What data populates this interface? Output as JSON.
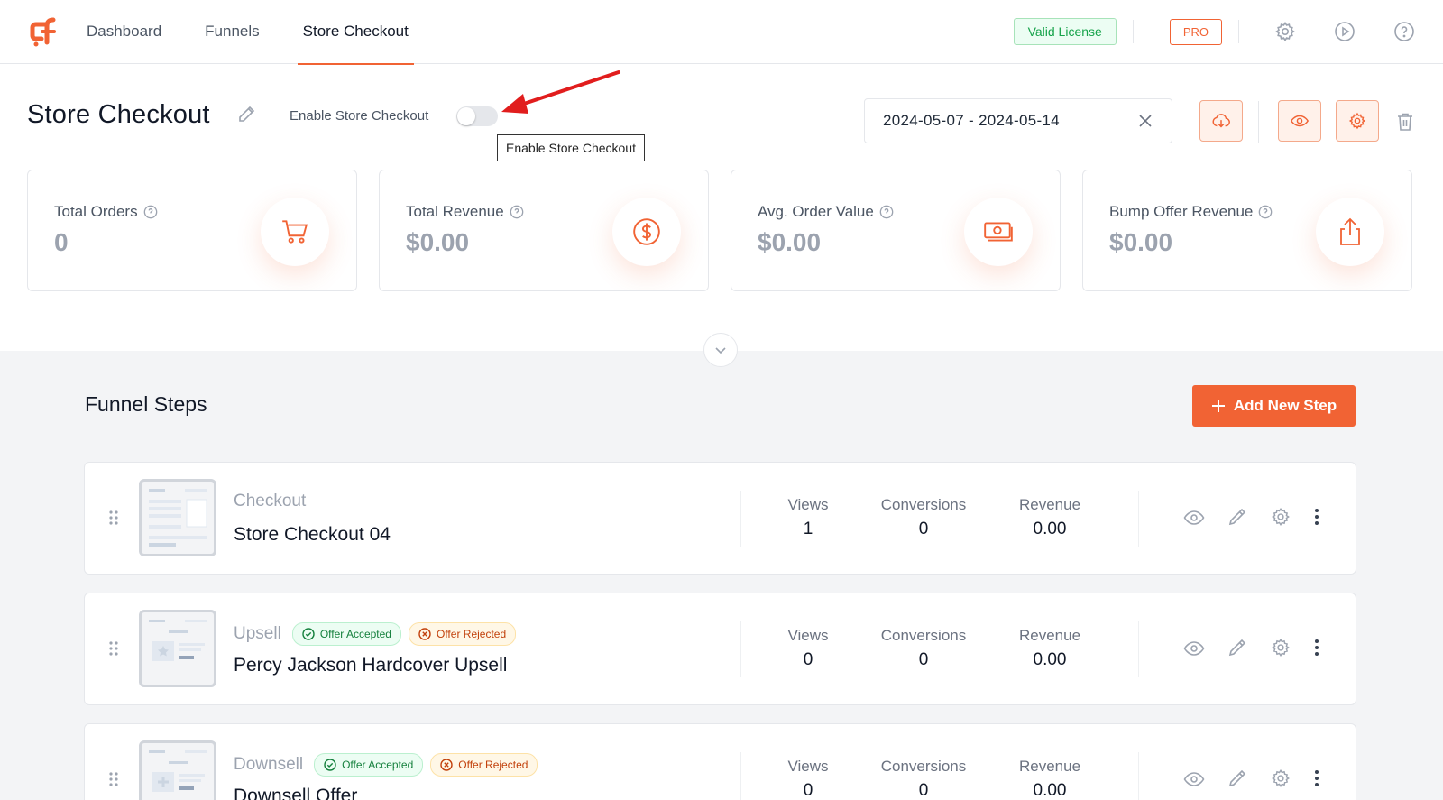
{
  "nav": {
    "items": [
      "Dashboard",
      "Funnels",
      "Store Checkout"
    ],
    "license_badge": "Valid License",
    "pro_badge": "PRO",
    "icons": [
      "gear-icon",
      "play-circle-icon",
      "help-circle-icon"
    ]
  },
  "header": {
    "title": "Store Checkout",
    "enable_label": "Enable Store Checkout",
    "enabled": false,
    "tooltip": "Enable Store Checkout",
    "date_range": "2024-05-07 - 2024-05-14"
  },
  "stats": [
    {
      "label": "Total Orders",
      "value": "0",
      "icon": "cart-icon"
    },
    {
      "label": "Total Revenue",
      "value": "$0.00",
      "icon": "dollar-circle-icon"
    },
    {
      "label": "Avg. Order Value",
      "value": "$0.00",
      "icon": "banknote-icon"
    },
    {
      "label": "Bump Offer Revenue",
      "value": "$0.00",
      "icon": "share-up-icon"
    }
  ],
  "funnel": {
    "title": "Funnel Steps",
    "add_button": "Add New Step",
    "metric_labels": {
      "views": "Views",
      "conversions": "Conversions",
      "revenue": "Revenue"
    },
    "steps": [
      {
        "type": "Checkout",
        "name": "Store Checkout 04",
        "views": "1",
        "conversions": "0",
        "revenue": "0.00",
        "badges": []
      },
      {
        "type": "Upsell",
        "name": "Percy Jackson Hardcover Upsell",
        "views": "0",
        "conversions": "0",
        "revenue": "0.00",
        "badges": [
          "Offer Accepted",
          "Offer Rejected"
        ]
      },
      {
        "type": "Downsell",
        "name": "Downsell Offer",
        "views": "0",
        "conversions": "0",
        "revenue": "0.00",
        "badges": [
          "Offer Accepted",
          "Offer Rejected"
        ]
      }
    ]
  },
  "colors": {
    "accent": "#f16334",
    "success": "#16a34a",
    "muted": "#9ca3af"
  }
}
